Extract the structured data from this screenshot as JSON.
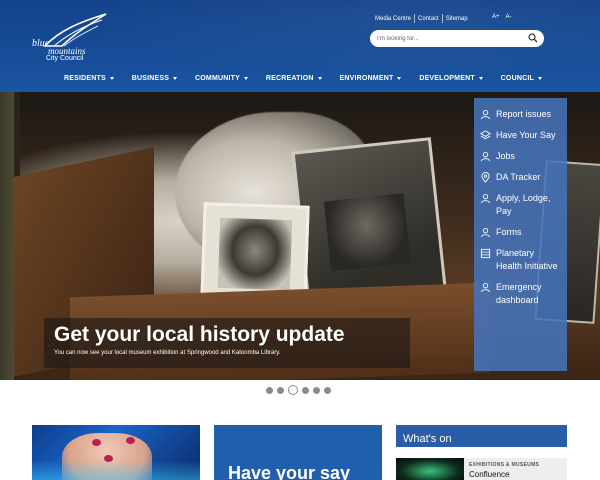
{
  "header": {
    "logo": {
      "line1": "blue",
      "line2": "mountains",
      "line3": "City Council"
    },
    "util_links": [
      "Media Centre",
      "Contact",
      "Sitemap"
    ],
    "font_size": {
      "increase": "A+",
      "decrease": "A-"
    },
    "search": {
      "placeholder": "I'm looking for..."
    },
    "nav": [
      "RESIDENTS",
      "BUSINESS",
      "COMMUNITY",
      "RECREATION",
      "ENVIRONMENT",
      "DEVELOPMENT",
      "COUNCIL"
    ]
  },
  "hero": {
    "title": "Get your local history update",
    "subtitle": "You can now see your local museum exhibition at Springwood and Katoomba Library."
  },
  "quick_links": [
    {
      "label": "Report issues",
      "icon": "person-icon"
    },
    {
      "label": "Have Your Say",
      "icon": "layers-icon"
    },
    {
      "label": "Jobs",
      "icon": "person-icon"
    },
    {
      "label": "DA Tracker",
      "icon": "map-pin-icon"
    },
    {
      "label": "Apply, Lodge, Pay",
      "icon": "person-icon"
    },
    {
      "label": "Forms",
      "icon": "person-icon"
    },
    {
      "label": "Planetary Health Initiative",
      "icon": "grid-icon"
    },
    {
      "label": "Emergency dashboard",
      "icon": "person-icon"
    }
  ],
  "carousel": {
    "count": 6,
    "active_index": 2
  },
  "cards": {
    "have_your_say": "Have your say"
  },
  "whats_on": {
    "title": "What's on",
    "event": {
      "category": "EXHIBITIONS & MUSEUMS",
      "name": "Confluence"
    }
  },
  "colors": {
    "header_blue": "#174c97",
    "panel_blue": "#4673b9",
    "accent_blue": "#2a5da8"
  }
}
